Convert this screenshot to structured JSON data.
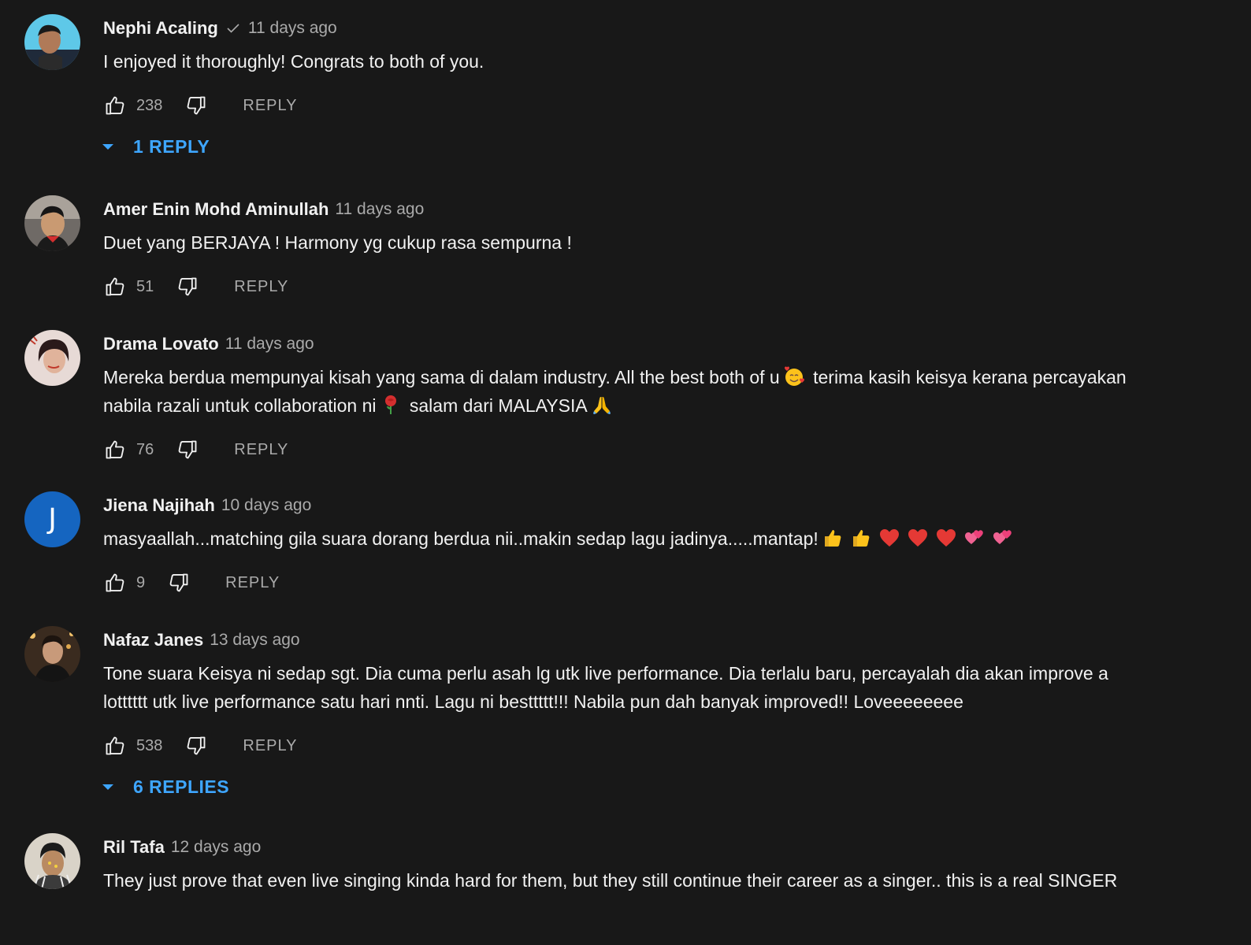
{
  "comments": [
    {
      "author": "Nephi Acaling",
      "verified": true,
      "time": "11 days ago",
      "text": "I enjoyed it thoroughly! Congrats to both of you.",
      "likes": "238",
      "reply_label": "REPLY",
      "replies_label": "1 REPLY"
    },
    {
      "author": "Amer Enin Mohd Aminullah",
      "time": "11 days ago",
      "text": "Duet yang BERJAYA ! Harmony yg cukup rasa sempurna !",
      "likes": "51",
      "reply_label": "REPLY"
    },
    {
      "author": "Drama Lovato",
      "time": "11 days ago",
      "text_parts": [
        "Mereka berdua mempunyai kisah yang sama di dalam industry. All the best both of u",
        " terima kasih keisya kerana percayakan nabila razali untuk collaboration ni",
        " salam dari MALAYSIA"
      ],
      "likes": "76",
      "reply_label": "REPLY"
    },
    {
      "author": "Jiena Najihah",
      "avatar_letter": "J",
      "time": "10 days ago",
      "text": "masyaallah...matching gila suara dorang berdua nii..makin sedap lagu jadinya.....mantap!",
      "likes": "9",
      "reply_label": "REPLY"
    },
    {
      "author": "Nafaz Janes",
      "time": "13 days ago",
      "text": "Tone suara Keisya ni sedap sgt. Dia cuma perlu asah lg utk live performance. Dia terlalu baru, percayalah dia akan improve a lotttttt utk live performance satu hari nnti. Lagu ni besttttt!!! Nabila pun dah banyak improved!! Loveeeeeeee",
      "likes": "538",
      "reply_label": "REPLY",
      "replies_label": "6 REPLIES"
    },
    {
      "author": "Ril Tafa",
      "time": "12 days ago",
      "text": "They just prove that even live singing kinda hard for them, but they still continue their career as a singer.. this is a real SINGER"
    }
  ],
  "colors": {
    "background": "#181818",
    "primary_text": "#f1f1f1",
    "secondary_text": "#aaaaaa",
    "link_blue": "#3ea6ff",
    "avatar_blue": "#1565c0"
  }
}
